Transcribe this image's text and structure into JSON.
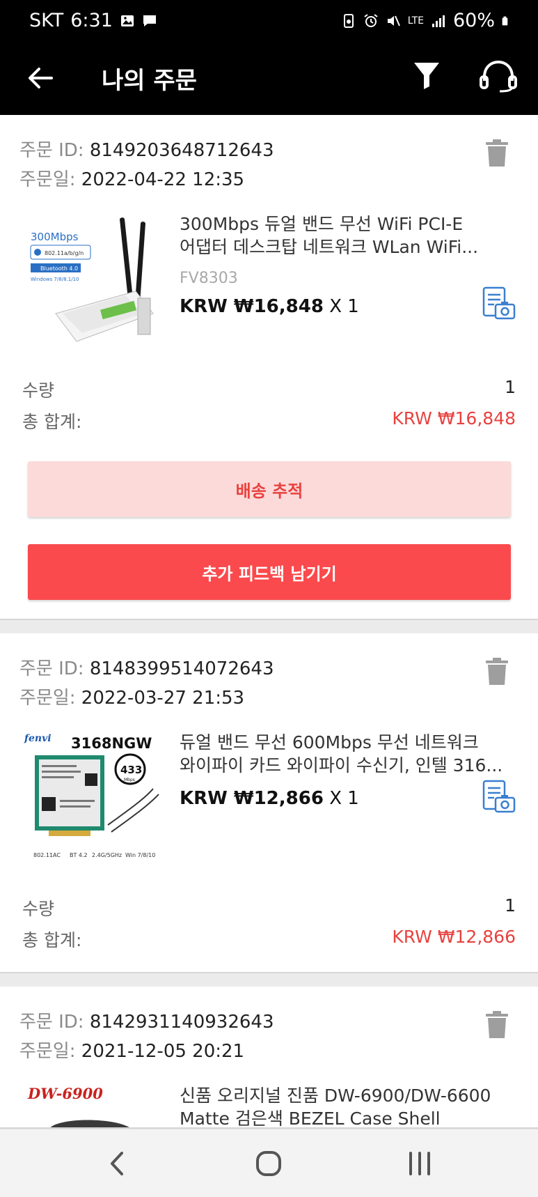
{
  "status_bar": {
    "carrier": "SKT",
    "time": "6:31",
    "network": "LTE",
    "battery": "60%",
    "icons": [
      "gallery-icon",
      "message-icon",
      "battery-saver-icon",
      "alarm-icon",
      "mute-icon",
      "signal-icon",
      "battery-icon"
    ]
  },
  "app_bar": {
    "title": "나의 주문",
    "icons": [
      "back-arrow-icon",
      "filter-icon",
      "customer-support-headset-icon"
    ]
  },
  "labels": {
    "order_id": "주문 ID:",
    "order_date": "주문일:",
    "quantity": "수량",
    "total": "총 합계:"
  },
  "orders": [
    {
      "order_id": "8149203648712643",
      "order_date": "2022-04-22 12:35",
      "product": {
        "title_line1": "300Mbps 듀얼 밴드 무선 WiFi PCI-E",
        "title_line2": "어댑터 데스크탑 네트워크 WLan WiFi...",
        "sku": "FV8303",
        "price": "KRW ₩16,848",
        "qty_suffix": "X 1",
        "image_text": {
          "speed": "300Mbps",
          "standard": "802.11a/b/g/n",
          "bluetooth": "Bluetooth 4.0",
          "os": "Windows 7/8/8.1/10"
        }
      },
      "quantity": "1",
      "total": "KRW ₩16,848",
      "buttons": {
        "track": "배송 추적",
        "feedback": "추가 피드백 남기기"
      }
    },
    {
      "order_id": "8148399514072643",
      "order_date": "2022-03-27 21:53",
      "product": {
        "title_line1": "듀얼 밴드 무선 600Mbps 무선 네트워크",
        "title_line2": "와이파이 카드 와이파이 수신기, 인텔 316...",
        "price": "KRW ₩12,866",
        "qty_suffix": "X 1",
        "image_text": {
          "brand": "fenvi",
          "model": "3168NGW",
          "speed": "433",
          "speed_unit": "Mbps",
          "features": [
            "802.11AC",
            "BT 4.2",
            "2.4G/5GHz",
            "Win 7/8/10"
          ]
        }
      },
      "quantity": "1",
      "total": "KRW ₩12,866"
    },
    {
      "order_id": "8142931140932643",
      "order_date": "2021-12-05 20:21",
      "product": {
        "title_line1": "신품 오리지널 진품 DW-6900/DW-6600",
        "title_line2": "Matte 검은색 BEZEL Case Shell",
        "image_text": {
          "model": "DW-6900"
        }
      }
    }
  ],
  "nav_bar": {
    "icons": [
      "nav-back-icon",
      "nav-home-icon",
      "nav-recents-icon"
    ]
  }
}
